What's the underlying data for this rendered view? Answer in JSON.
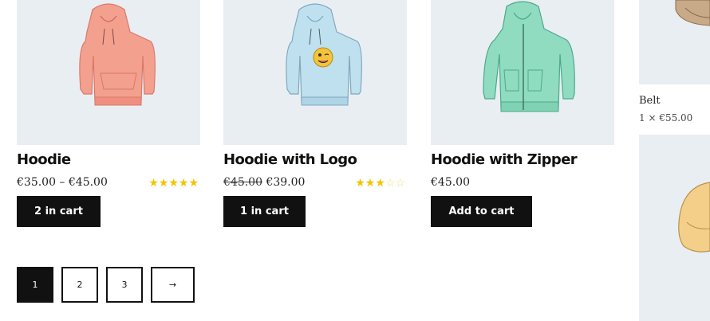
{
  "products": [
    {
      "title": "Hoodie",
      "price": "€35.00 – €45.00",
      "rating_stars": "★★★★★",
      "rating_empty": "",
      "rating_value": 5,
      "button": "2 in cart",
      "color": "#f4a08f"
    },
    {
      "title": "Hoodie with Logo",
      "old_price": "€45.00",
      "price": "€39.00",
      "rating_stars": "★★★",
      "rating_empty": "☆☆",
      "rating_value": 3,
      "button": "1 in cart",
      "color": "#bfe0ee"
    },
    {
      "title": "Hoodie with Zipper",
      "price": "€45.00",
      "button": "Add to cart",
      "color": "#8fdcc0"
    }
  ],
  "pagination": {
    "pages": [
      "1",
      "2",
      "3"
    ],
    "current": "1",
    "next": "→"
  },
  "cart_widget": {
    "item_name": "Belt",
    "item_qty": "1 × €55.00"
  },
  "colors": {
    "thumb_bg": "#e9eef3",
    "button_bg": "#111111",
    "star": "#f2c400"
  }
}
